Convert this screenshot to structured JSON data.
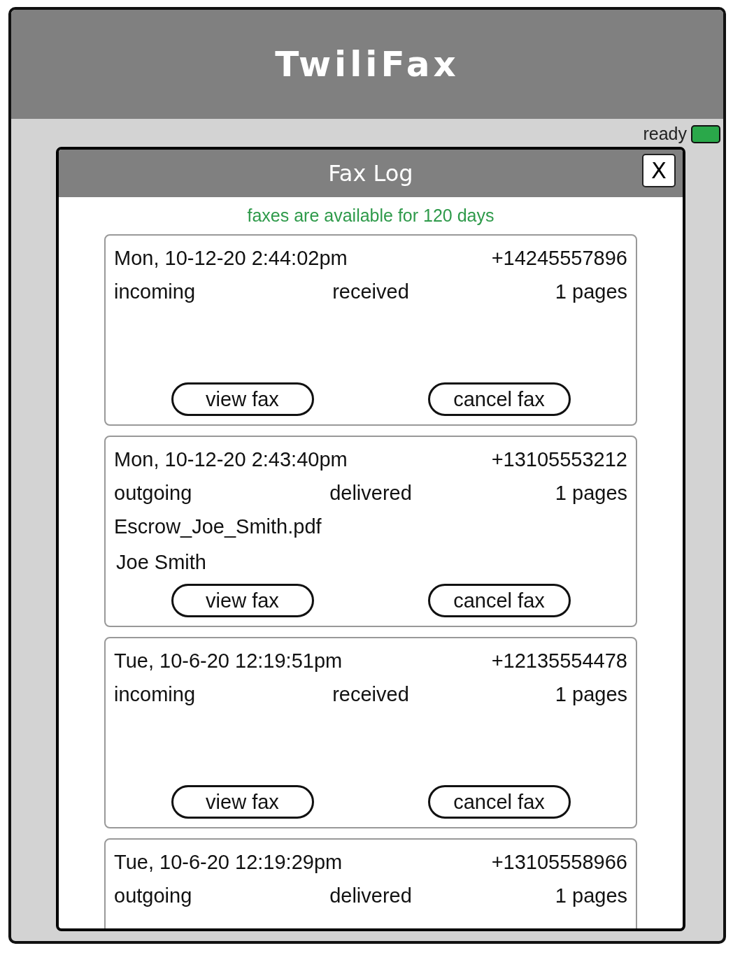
{
  "app": {
    "title": "TwiliFax"
  },
  "status": {
    "label": "ready",
    "kind": "ready"
  },
  "dialog": {
    "title": "Fax Log",
    "close_label": "X",
    "note": "faxes are available for 120 days"
  },
  "faxes": [
    {
      "datetime": "Mon, 10-12-20 2:44:02pm",
      "number": "+14245557896",
      "direction": "incoming",
      "status": "received",
      "pages": "1 pages",
      "buttons": [
        "view fax",
        "cancel fax"
      ]
    },
    {
      "datetime": "Mon, 10-12-20 2:43:40pm",
      "number": "+13105553212",
      "direction": "outgoing",
      "status": "delivered",
      "pages": "1 pages",
      "file": "Escrow_Joe_Smith.pdf",
      "recipient": "Joe Smith",
      "buttons": [
        "view fax",
        "cancel fax"
      ]
    },
    {
      "datetime": "Tue, 10-6-20 12:19:51pm",
      "number": "+12135554478",
      "direction": "incoming",
      "status": "received",
      "pages": "1 pages",
      "buttons": [
        "view fax",
        "cancel fax"
      ]
    },
    {
      "datetime": "Tue, 10-6-20 12:19:29pm",
      "number": "+13105558966",
      "direction": "outgoing",
      "status": "delivered",
      "pages": "1 pages"
    }
  ]
}
